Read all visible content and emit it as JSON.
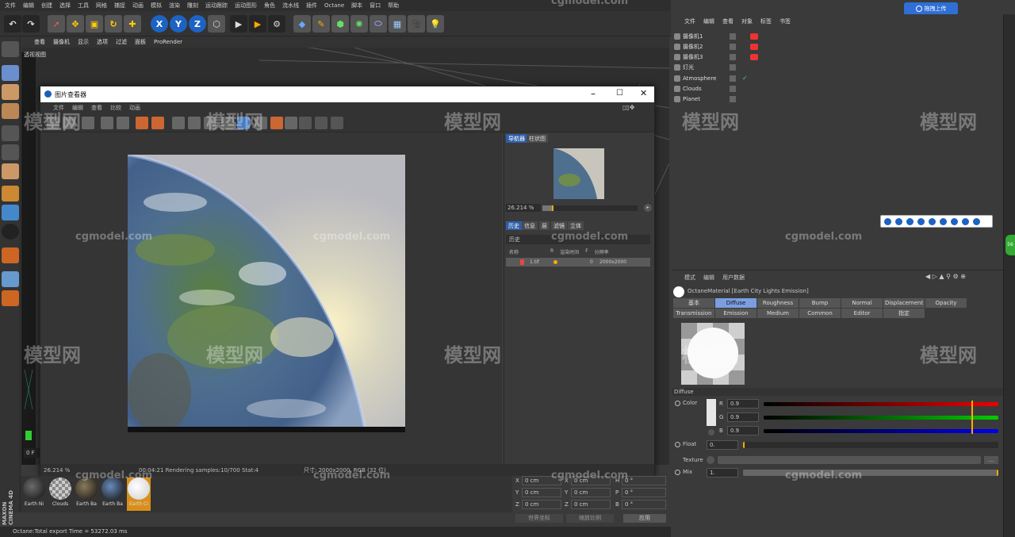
{
  "main_menu": [
    "文件",
    "编辑",
    "创建",
    "选择",
    "工具",
    "网格",
    "捕捉",
    "动画",
    "模拟",
    "渲染",
    "雕刻",
    "运动跟踪",
    "运动图形",
    "角色",
    "流水线",
    "插件",
    "Octane",
    "脚本",
    "窗口",
    "帮助"
  ],
  "viewport": {
    "menu": [
      "查看",
      "摄像机",
      "显示",
      "选项",
      "过滤",
      "面板",
      "ProRender"
    ],
    "label": "透视视图"
  },
  "picture_viewer": {
    "title": "图片查看器",
    "menu": [
      "文件",
      "编辑",
      "查看",
      "比较",
      "动画"
    ],
    "side_tabs_top": [
      "导航器",
      "柱状图"
    ],
    "zoom": "26.214 %",
    "side_tabs": [
      "历史",
      "信息",
      "层",
      "滤镜",
      "立体"
    ],
    "history_label": "历史",
    "history_headers": [
      "名称",
      "R",
      "渲染时间",
      "F",
      "分辨率"
    ],
    "history_row": {
      "name": "1.tif",
      "time": "0",
      "res": "2000x2000"
    },
    "status_zoom": "26.214 %",
    "status_text": "00:04:21 Rendering samples:10/700 Stat:4",
    "status_size": "尺寸: 2000x2000, RGB (32 位)"
  },
  "objects": {
    "menu": [
      "文件",
      "编辑",
      "查看",
      "对象",
      "标签",
      "书签"
    ],
    "items": [
      "摄像机1",
      "摄像机2",
      "摄像机3",
      "灯光",
      "Atmosphere",
      "Clouds",
      "Planet"
    ]
  },
  "attributes": {
    "menu": [
      "模式",
      "编辑",
      "用户数据"
    ],
    "material_name": "OctaneMaterial [Earth City Lights Emission]",
    "tabs_row1": [
      "基本",
      "Diffuse",
      "Roughness",
      "Bump",
      "Normal",
      "Displacement",
      "Opacity"
    ],
    "tabs_row2": [
      "Transmission",
      "Emission",
      "Medium",
      "Common",
      "Editor",
      "指定"
    ],
    "section": "Diffuse",
    "color_label": "Color",
    "r_label": "R",
    "r_value": "0.9",
    "g_label": "G",
    "g_value": "0.9",
    "b_label": "B",
    "b_value": "0.9",
    "float_label": "Float",
    "float_value": "0.",
    "texture_label": "Texture",
    "mix_label": "Mix",
    "mix_value": "1."
  },
  "materials": [
    "Earth Ni",
    "Clouds",
    "Earth Ba",
    "Earth Ba",
    "Earth Ci"
  ],
  "coords": {
    "x": "X",
    "y": "Y",
    "z": "Z",
    "zero_cm": "0 cm",
    "h": "H",
    "p": "P",
    "b": "B",
    "zero_deg": "0 °",
    "world": "世界坐标",
    "scale": "缩放比例",
    "apply": "应用"
  },
  "frame": "0 F",
  "status": "Octane:Total export Time = 53272.03 ms",
  "upload_button": "拖拽上传",
  "watermark_brand": "模型网",
  "watermark_url": "cgmodel.com",
  "maxon": "MAXON",
  "cinema4d": "CINEMA 4D"
}
